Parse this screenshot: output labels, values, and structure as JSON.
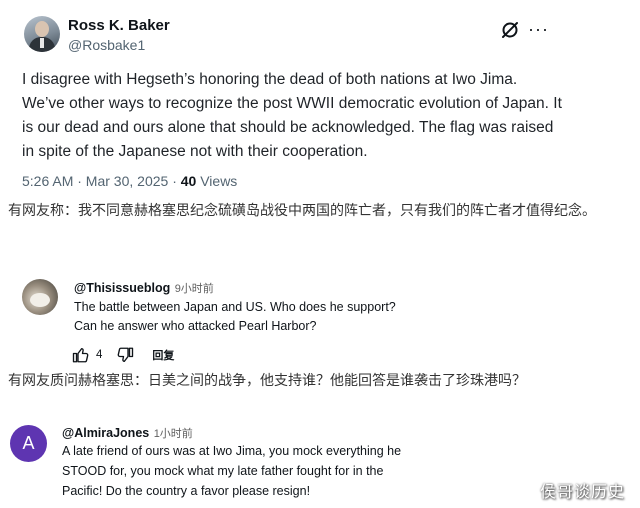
{
  "tweet": {
    "author_name": "Ross K. Baker",
    "author_handle": "@Rosbake1",
    "text": "I disagree with Hegseth’s honoring the dead of both nations at Iwo Jima. We’ve other ways to recognize the post WWII democratic evolution of Japan. It is our dead and ours alone that should be acknowledged. The flag was raised in spite of the Japanese not with their cooperation.",
    "timestamp": "5:26 AM · Mar 30, 2025 · ",
    "views_count": "40",
    "views_label": " Views",
    "icons": [
      "grok-icon",
      "more-icon"
    ]
  },
  "caption_1": "有网友称：我不同意赫格塞思纪念硫磺岛战役中两国的阵亡者，只有我们的阵亡者才值得纪念。",
  "comment_1": {
    "username": "@Thisissueblog",
    "time": "9小时前",
    "line1": "The battle between Japan and US. Who does he support?",
    "line2": "Can he answer who attacked Pearl Harbor?",
    "like_count": "4",
    "reply_label": "回复"
  },
  "caption_2": "有网友质问赫格塞思：日美之间的战争，他支持谁？他能回答是谁袭击了珍珠港吗？",
  "comment_2": {
    "avatar_letter": "A",
    "avatar_color": "#5e35b1",
    "username": "@AlmiraJones",
    "time": "1小时前",
    "line1": "A late friend of ours was at Iwo Jima, you mock everything he",
    "line2": "STOOD for, you mock what my late father fought for in the",
    "line3": "Pacific!  Do the country a favor please resign!"
  },
  "watermark": "侯哥谈历史"
}
